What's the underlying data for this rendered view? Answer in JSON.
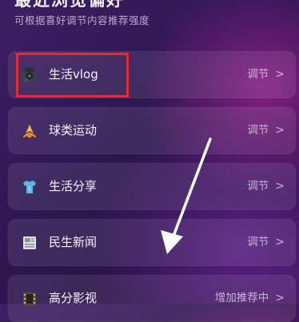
{
  "header": {
    "title": "最近浏览偏好",
    "subtitle": "可根据喜好调节内容推荐强度"
  },
  "items": [
    {
      "label": "生活vlog",
      "action": "调节",
      "icon": "camera-icon"
    },
    {
      "label": "球类运动",
      "action": "调节",
      "icon": "badminton-icon"
    },
    {
      "label": "生活分享",
      "action": "调节",
      "icon": "shirt-icon"
    },
    {
      "label": "民生新闻",
      "action": "调节",
      "icon": "newspaper-icon"
    },
    {
      "label": "高分影视",
      "action": "增加推荐中",
      "icon": "film-icon"
    }
  ],
  "colors": {
    "highlight": "#e22b33",
    "arrow": "#ffffff"
  }
}
